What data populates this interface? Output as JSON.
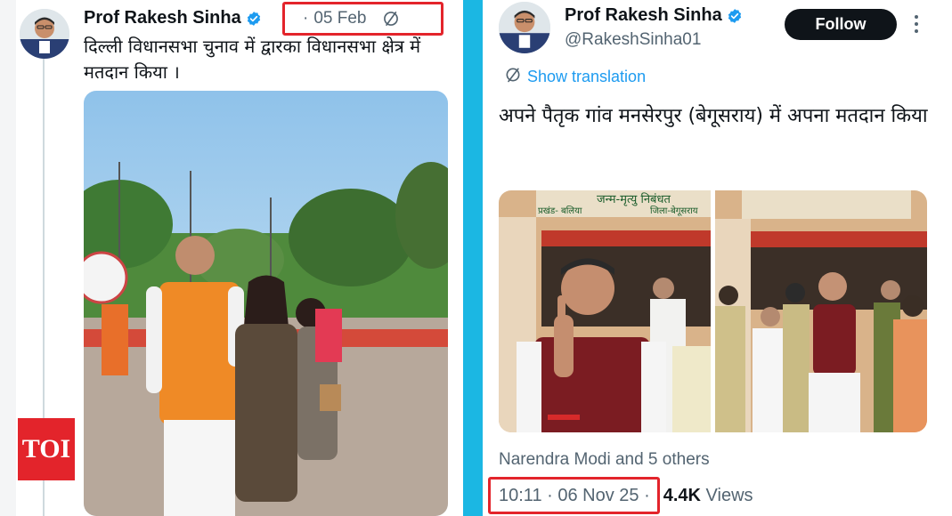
{
  "left_tweet": {
    "display_name": "Prof Rakesh Sinha",
    "date": "05 Feb",
    "date_separator": "·",
    "text": "दिल्ली विधानसभा चुनाव में द्वारका  विधानसभा क्षेत्र में मतदान किया ।"
  },
  "right_tweet": {
    "display_name": "Prof Rakesh Sinha",
    "handle": "@RakeshSinha01",
    "follow_label": "Follow",
    "show_translation": "Show translation",
    "text": "अपने पैतृक गांव मनसेरपुर (बेगूसराय) में अपना मतदान किया",
    "liked_by": "Narendra Modi and 5 others",
    "timestamp": "10:11 · 06 Nov 25 ·",
    "views_count": "4.4K",
    "views_label": " Views",
    "sign_board_title": "जन्म-मृत्यु निबंधत",
    "sign_board_left": "प्रखंड- बलिया",
    "sign_board_right": "जिला-बेगूसराय"
  },
  "watermark": {
    "text": "TOI",
    "color": "#e3242b"
  },
  "colors": {
    "highlight_box": "#e3242b",
    "separator": "#1bb7e3",
    "link": "#1d9bf0",
    "verified_badge": "#1d9bf0",
    "secondary_text": "#536471"
  },
  "icons": {
    "verified": "verified-badge-icon",
    "no_edit": "circle-slash-icon",
    "translate": "globe-icon",
    "more": "more-vertical-icon"
  }
}
